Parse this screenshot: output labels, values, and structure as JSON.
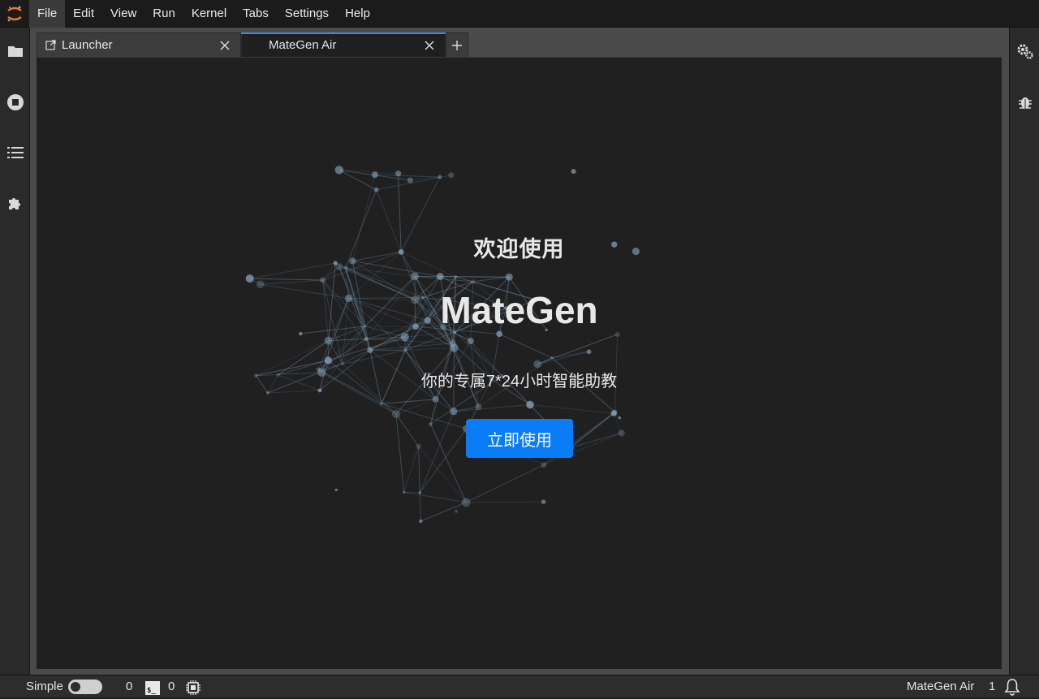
{
  "menubar": {
    "items": [
      "File",
      "Edit",
      "View",
      "Run",
      "Kernel",
      "Tabs",
      "Settings",
      "Help"
    ],
    "active": "File"
  },
  "tabs": [
    {
      "label": "Launcher",
      "icon": "external-link-icon"
    },
    {
      "label": "MateGen Air",
      "active": true
    }
  ],
  "main": {
    "welcome": "欢迎使用",
    "product": "MateGen",
    "tagline": "你的专属7*24小时智能助教",
    "cta": "立即使用"
  },
  "leftbar": [
    "folder-icon",
    "stop-circle-icon",
    "list-icon",
    "puzzle-icon"
  ],
  "rightbar": [
    "gears-icon",
    "bug-icon"
  ],
  "statusbar": {
    "mode_label": "Simple",
    "terminals": "0",
    "kernels": "0",
    "kernel_name": "MateGen Air",
    "notifications": "1"
  },
  "colors": {
    "accent": "#0a7cf6",
    "tab_highlight": "#3b8cf0",
    "background": "#202020"
  }
}
